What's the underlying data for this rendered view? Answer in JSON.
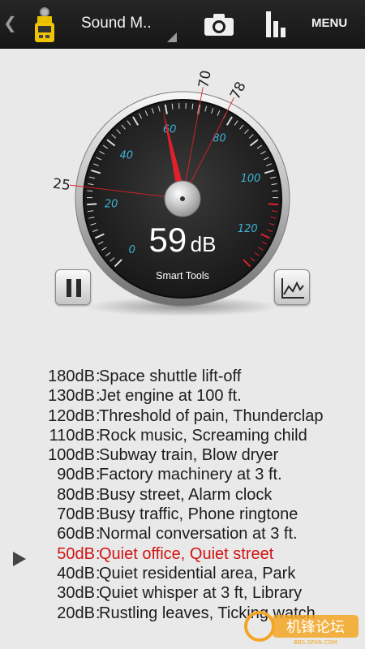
{
  "actionbar": {
    "title": "Sound M..",
    "menu_label": "MENU",
    "back_icon": "chevron-left-icon",
    "app_icon": "sound-meter-app-icon",
    "camera_icon": "camera-icon",
    "chart_icon": "bar-chart-icon"
  },
  "gauge": {
    "ticks": [
      "0",
      "20",
      "40",
      "60",
      "80",
      "100",
      "120"
    ],
    "reading_value": "59",
    "reading_unit": "dB",
    "brand": "Smart Tools",
    "needle_db": 59,
    "min_marker": "25",
    "avg_marker": "70",
    "max_marker": "78",
    "accent": "#e0202a"
  },
  "controls": {
    "pause_icon": "pause-icon",
    "graph_icon": "line-graph-icon"
  },
  "reference": {
    "separator": ":",
    "items": [
      {
        "db": "180dB",
        "desc": "Space shuttle lift-off"
      },
      {
        "db": "130dB",
        "desc": "Jet engine at 100 ft."
      },
      {
        "db": "120dB",
        "desc": "Threshold of pain, Thunderclap"
      },
      {
        "db": "110dB",
        "desc": "Rock music, Screaming child"
      },
      {
        "db": "100dB",
        "desc": "Subway train, Blow dryer"
      },
      {
        "db": "90dB",
        "desc": "Factory machinery at 3 ft."
      },
      {
        "db": "80dB",
        "desc": "Busy street, Alarm clock"
      },
      {
        "db": "70dB",
        "desc": "Busy traffic, Phone ringtone"
      },
      {
        "db": "60dB",
        "desc": "Normal conversation at 3 ft."
      },
      {
        "db": "50dB",
        "desc": "Quiet office, Quiet street"
      },
      {
        "db": "40dB",
        "desc": "Quiet residential area, Park"
      },
      {
        "db": "30dB",
        "desc": "Quiet whisper at 3 ft, Library"
      },
      {
        "db": "20dB",
        "desc": "Rustling leaves, Ticking watch"
      }
    ],
    "active_index": 9,
    "active_color": "#d11414"
  },
  "watermark": {
    "text": "机锋论坛",
    "url_text": "BBS.GFAN.COM"
  }
}
